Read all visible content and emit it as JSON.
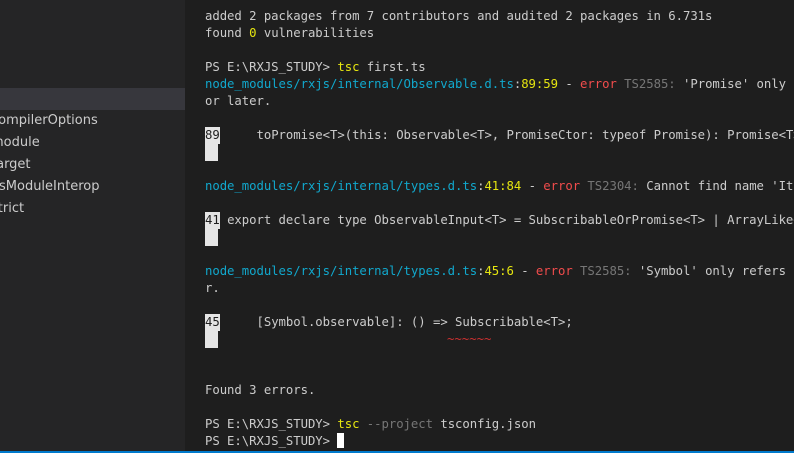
{
  "sidebar": {
    "items": [
      {
        "label": "compilerOptions",
        "selected": false
      },
      {
        "label": "module",
        "selected": false
      },
      {
        "label": "target",
        "selected": false
      },
      {
        "label": "esModuleInterop",
        "selected": false
      },
      {
        "label": "strict",
        "selected": false
      }
    ]
  },
  "terminal": {
    "l1": "added 2 packages from 7 contributors and audited 2 packages in 6.731s",
    "l2a": "found ",
    "l2b": "0",
    "l2c": " vulnerabilities",
    "p1_prompt": "PS E:\\RXJS_STUDY> ",
    "p1_cmd": "tsc",
    "p1_arg": " first.ts",
    "e1_file": "node_modules/rxjs/internal/Observable.d.ts",
    "e1_colon": ":",
    "e1_pos": "89:59",
    "e1_dash": " - ",
    "e1_error": "error",
    "e1_code": " TS2585: ",
    "e1_msg": "'Promise' only refe",
    "e1_cont": "or later.",
    "e1_gut": "89",
    "e1_src": "     toPromise<T>(this: Observable<T>, PromiseCtor: typeof Promise): Promise<T>;",
    "e1_squig": "~~~~~~~",
    "e2_file": "node_modules/rxjs/internal/types.d.ts",
    "e2_colon": ":",
    "e2_pos": "41:84",
    "e2_dash": " - ",
    "e2_error": "error",
    "e2_code": " TS2304: ",
    "e2_msg": "Cannot find name 'Iterab",
    "e2_gut": "41",
    "e2_src": " export declare type ObservableInput<T> = SubscribableOrPromise<T> | ArrayLike<T>",
    "e3_file": "node_modules/rxjs/internal/types.d.ts",
    "e3_colon": ":",
    "e3_pos": "45:6",
    "e3_dash": " - ",
    "e3_error": "error",
    "e3_code": " TS2585: ",
    "e3_msg": "'Symbol' only refers to a",
    "e3_cont": "r.",
    "e3_gut": "45",
    "e3_src": "     [Symbol.observable]: () => Subscribable<T>;",
    "e3_squig": "~~~~~~",
    "summary": "Found 3 errors.",
    "p2_prompt": "PS E:\\RXJS_STUDY> ",
    "p2_cmd": "tsc",
    "p2_flag": " --project",
    "p2_arg": " tsconfig.json",
    "p3_prompt": "PS E:\\RXJS_STUDY> "
  },
  "colors": {
    "yellow": "#e5e510",
    "cyan": "#11a8cd",
    "red": "#f14c4c",
    "gray": "#767676"
  }
}
